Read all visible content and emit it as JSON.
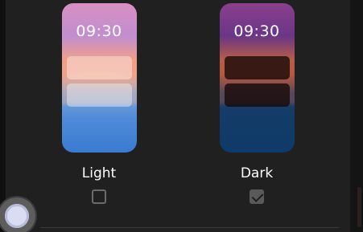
{
  "appearance": {
    "options": [
      {
        "id": "light",
        "label": "Light",
        "time": "09:30",
        "checked": false
      },
      {
        "id": "dark",
        "label": "Dark",
        "time": "09:30",
        "checked": true
      }
    ]
  },
  "icons": {
    "checkbox_checked": "check-icon",
    "floating_button": "assistive-touch-icon"
  },
  "colors": {
    "background": "#202020",
    "label": "#ffffff",
    "checkbox": "#5a5a5a"
  }
}
